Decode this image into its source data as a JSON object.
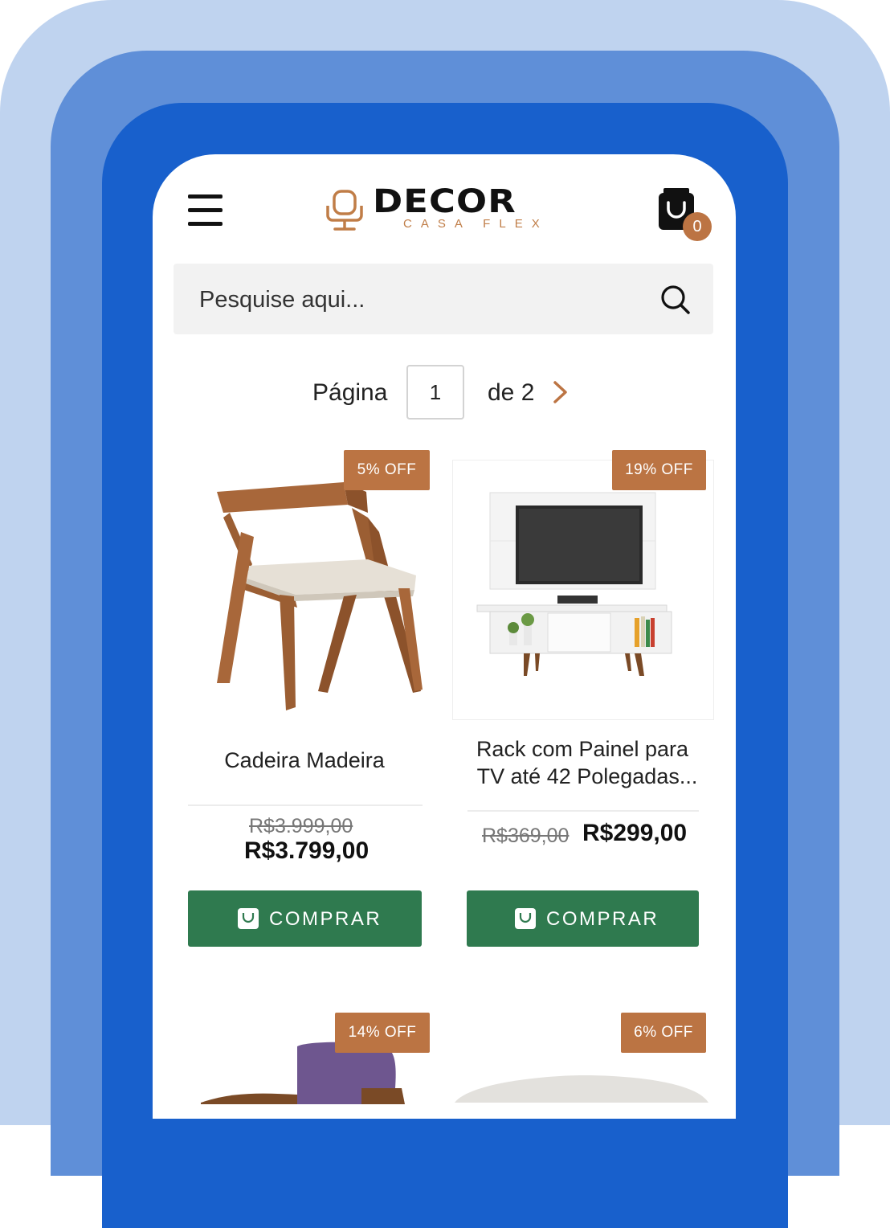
{
  "brand": {
    "name": "DECOR",
    "tagline": "CASA FLEX",
    "accent": "#bc7443"
  },
  "cart": {
    "count": "0"
  },
  "search": {
    "placeholder": "Pesquise aqui..."
  },
  "pagination": {
    "label": "Página",
    "current": "1",
    "of_label": "de 2"
  },
  "products": [
    {
      "badge": "5% OFF",
      "name": "Cadeira Madeira",
      "old_price": "R$3.999,00",
      "price": "R$3.799,00",
      "button": "COMPRAR"
    },
    {
      "badge": "19% OFF",
      "name_line1": "Rack com Painel para",
      "name_line2": "TV até 42 Polegadas...",
      "old_price": "R$369,00",
      "price": "R$299,00",
      "button": "COMPRAR"
    },
    {
      "badge": "14% OFF"
    },
    {
      "badge": "6% OFF"
    }
  ],
  "colors": {
    "button_green": "#2f7a4f",
    "frame_blue": "#1860cc"
  }
}
